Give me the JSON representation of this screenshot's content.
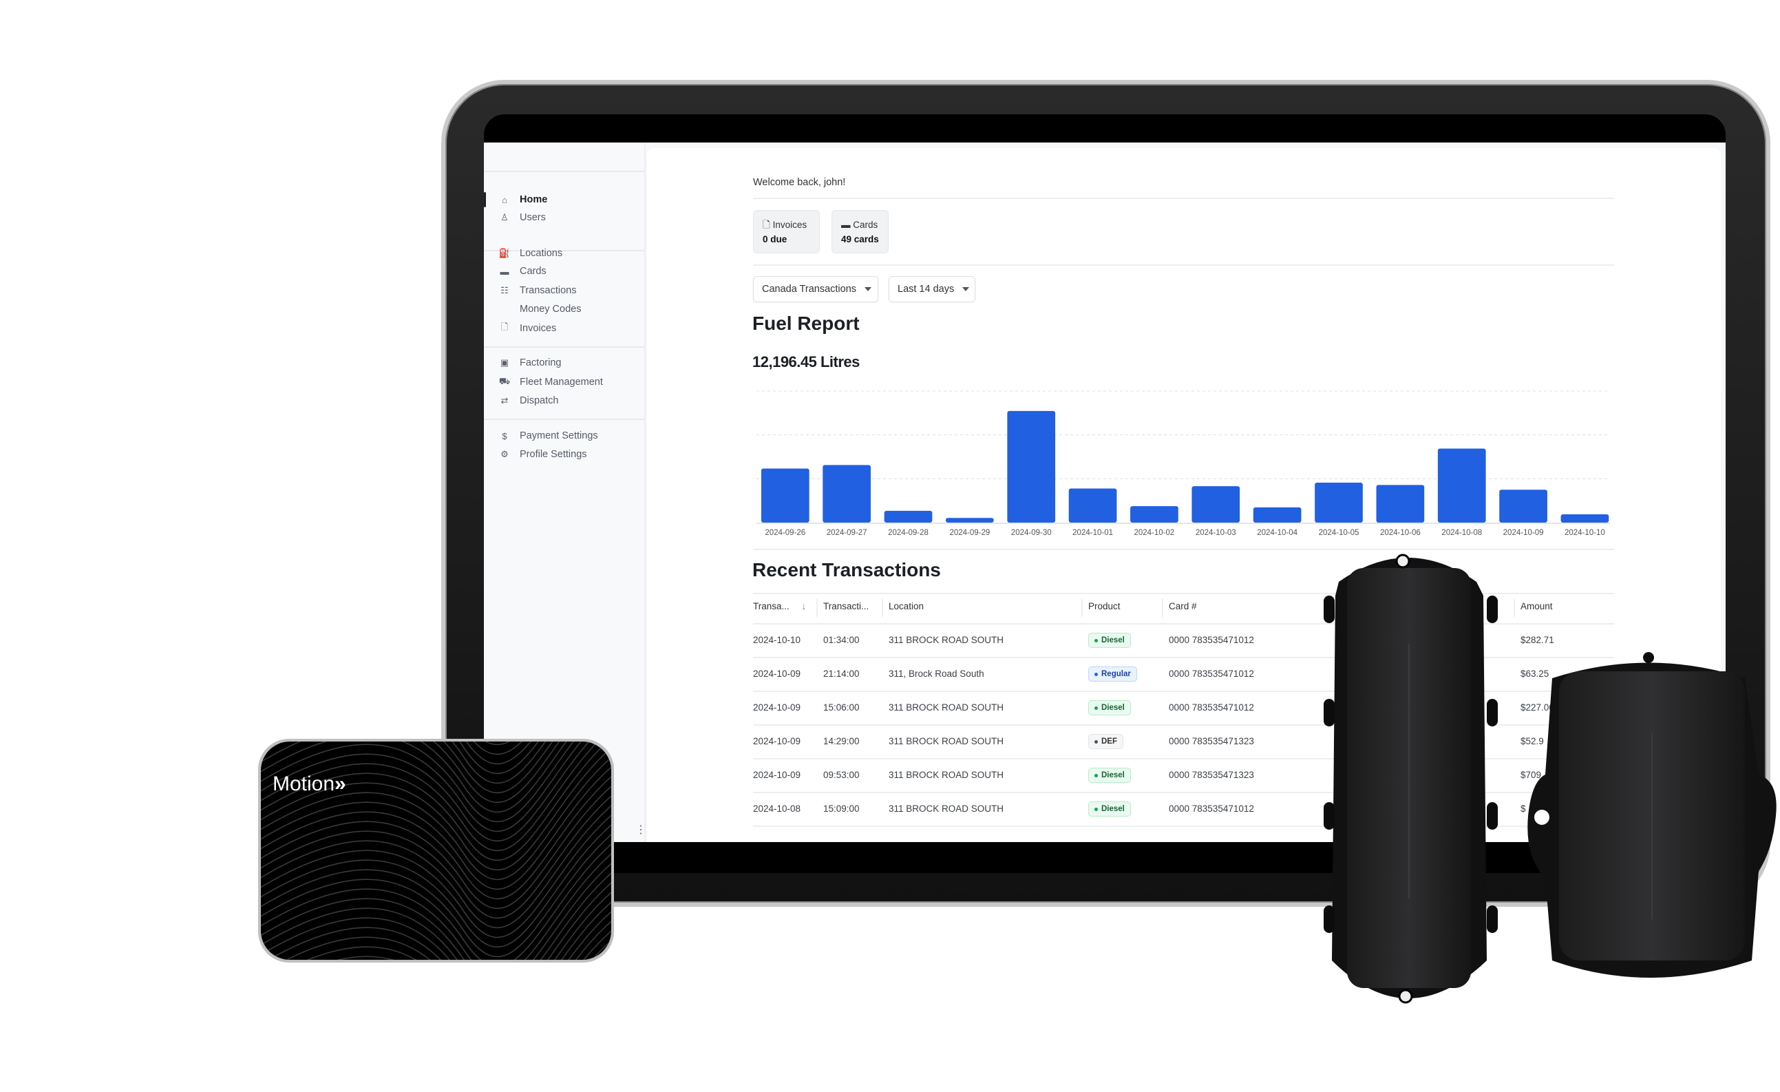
{
  "welcome": "Welcome back, john!",
  "sidebar": {
    "items": [
      {
        "label": "Home",
        "icon": "home-icon",
        "active": true
      },
      {
        "label": "Users",
        "icon": "user-icon"
      },
      {
        "label": "Locations",
        "icon": "fuel-pump-icon"
      },
      {
        "label": "Cards",
        "icon": "card-icon"
      },
      {
        "label": "Transactions",
        "icon": "list-icon"
      },
      {
        "label": "Money Codes",
        "icon": "code-icon"
      },
      {
        "label": "Invoices",
        "icon": "document-icon"
      },
      {
        "label": "Factoring",
        "icon": "cash-icon"
      },
      {
        "label": "Fleet Management",
        "icon": "truck-icon"
      },
      {
        "label": "Dispatch",
        "icon": "route-icon"
      },
      {
        "label": "Payment Settings",
        "icon": "dollar-icon"
      },
      {
        "label": "Profile Settings",
        "icon": "gear-icon"
      }
    ]
  },
  "stats": {
    "invoices": {
      "label": "Invoices",
      "value": "0 due"
    },
    "cards": {
      "label": "Cards",
      "value": "49 cards"
    }
  },
  "filters": {
    "account": "Canada Transactions",
    "range": "Last 14 days"
  },
  "fuel_report": {
    "title": "Fuel Report",
    "total": "12,196.45 Litres"
  },
  "chart_data": {
    "type": "bar",
    "categories": [
      "2024-09-26",
      "2024-09-27",
      "2024-09-28",
      "2024-09-29",
      "2024-09-30",
      "2024-10-01",
      "2024-10-02",
      "2024-10-03",
      "2024-10-04",
      "2024-10-05",
      "2024-10-06",
      "2024-10-08",
      "2024-10-09",
      "2024-10-10"
    ],
    "values": [
      1233,
      1313,
      268,
      107,
      2546,
      777,
      375,
      831,
      348,
      911,
      858,
      1689,
      750,
      188
    ],
    "ylim": [
      0,
      3000
    ],
    "grid": true,
    "color": "#2160e0"
  },
  "transactions": {
    "title": "Recent Transactions",
    "columns": [
      "Transa...",
      "Transacti...",
      "Location",
      "Product",
      "Card #",
      "Amount"
    ],
    "rows": [
      {
        "date": "2024-10-10",
        "time": "01:34:00",
        "location": "311 BROCK ROAD SOUTH",
        "product": "Diesel",
        "card": "0000 783535471012",
        "amount": "$282.71"
      },
      {
        "date": "2024-10-09",
        "time": "21:14:00",
        "location": "311, Brock Road South",
        "product": "Regular",
        "card": "0000 783535471012",
        "amount": "$63.25"
      },
      {
        "date": "2024-10-09",
        "time": "15:06:00",
        "location": "311 BROCK ROAD SOUTH",
        "product": "Diesel",
        "card": "0000 783535471012",
        "amount": "$227.06"
      },
      {
        "date": "2024-10-09",
        "time": "14:29:00",
        "location": "311 BROCK ROAD SOUTH",
        "product": "DEF",
        "card": "0000 783535471323",
        "amount": "$52.9"
      },
      {
        "date": "2024-10-09",
        "time": "09:53:00",
        "location": "311 BROCK ROAD SOUTH",
        "product": "Diesel",
        "card": "0000 783535471323",
        "amount": "$709"
      },
      {
        "date": "2024-10-08",
        "time": "15:09:00",
        "location": "311 BROCK ROAD SOUTH",
        "product": "Diesel",
        "card": "0000 783535471012",
        "amount": "$"
      }
    ]
  },
  "product_colors": {
    "Diesel": "#16a34a",
    "Regular": "#2563eb",
    "DEF": "#4b5563"
  },
  "card_brand": "Motion"
}
